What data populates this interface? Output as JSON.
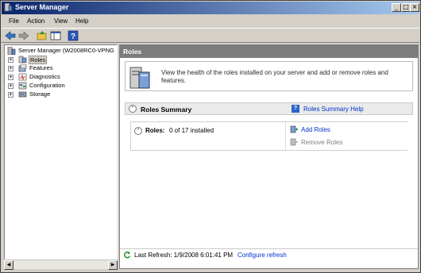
{
  "window": {
    "title": "Server Manager"
  },
  "menu": [
    "File",
    "Action",
    "View",
    "Help"
  ],
  "tree": [
    {
      "label": "Server Manager (W2008RC0-VPNG",
      "icon": "server-icon",
      "level": 0,
      "expander": ""
    },
    {
      "label": "Roles",
      "icon": "roles-icon",
      "level": 1,
      "expander": "+",
      "selected": true
    },
    {
      "label": "Features",
      "icon": "features-icon",
      "level": 1,
      "expander": "+"
    },
    {
      "label": "Diagnostics",
      "icon": "diagnostics-icon",
      "level": 1,
      "expander": "+"
    },
    {
      "label": "Configuration",
      "icon": "configuration-icon",
      "level": 1,
      "expander": "+"
    },
    {
      "label": "Storage",
      "icon": "storage-icon",
      "level": 1,
      "expander": "+"
    }
  ],
  "panel": {
    "title": "Roles",
    "intro": "View the health of the roles installed on your server and add or remove roles and features.",
    "summary": {
      "title": "Roles Summary",
      "help_link": "Roles Summary Help",
      "roles_label": "Roles:",
      "roles_count": "0 of 17 installed",
      "actions": {
        "add": "Add Roles",
        "remove": "Remove Roles"
      }
    },
    "refresh": {
      "text": "Last Refresh: 1/9/2008 6:01:41 PM",
      "link": "Configure refresh"
    }
  }
}
